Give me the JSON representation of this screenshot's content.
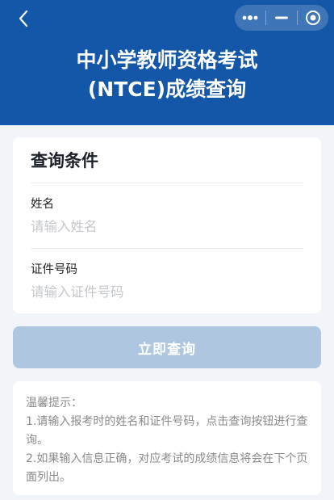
{
  "header": {
    "title_line1": "中小学教师资格考试",
    "title_line2": "(NTCE)成绩查询",
    "background_color": "#1457a8",
    "back_icon": "chevron-left-icon",
    "capsule": {
      "more_icon": "more-dots-icon",
      "minimize_icon": "minimize-icon",
      "close_icon": "target-close-icon"
    }
  },
  "form": {
    "title": "查询条件",
    "name_label": "姓名",
    "name_placeholder": "请输入姓名",
    "name_value": "",
    "id_label": "证件号码",
    "id_placeholder": "请输入证件号码",
    "id_value": ""
  },
  "submit": {
    "label": "立即查询",
    "color": "#aec6df"
  },
  "tips": {
    "heading": "温馨提示：",
    "line1": "1.请输入报考时的姓名和证件号码，点击查询按钮进行查询。",
    "line2": "2.如果输入信息正确，对应考试的成绩信息将会在下个页面列出。"
  }
}
